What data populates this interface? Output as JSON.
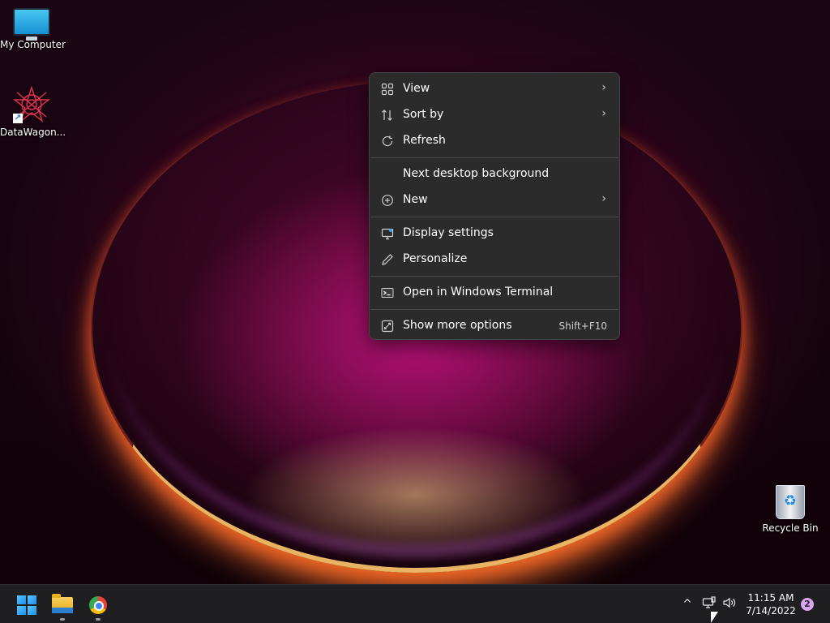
{
  "desktop": {
    "icons": [
      {
        "label": "My Computer",
        "icon": "monitor-icon"
      },
      {
        "label": "DataWagon...",
        "icon": "datawagon-star-icon"
      },
      {
        "label": "Recycle Bin",
        "icon": "recycle-bin-icon"
      }
    ]
  },
  "context_menu": {
    "items": [
      {
        "label": "View",
        "icon": "grid-icon",
        "submenu": true
      },
      {
        "label": "Sort by",
        "icon": "sort-icon",
        "submenu": true
      },
      {
        "label": "Refresh",
        "icon": "refresh-icon"
      },
      {
        "label": "Next desktop background",
        "icon": ""
      },
      {
        "label": "New",
        "icon": "plus-circle-icon",
        "submenu": true
      },
      {
        "label": "Display settings",
        "icon": "display-icon"
      },
      {
        "label": "Personalize",
        "icon": "pen-icon"
      },
      {
        "label": "Open in Windows Terminal",
        "icon": "terminal-icon"
      },
      {
        "label": "Show more options",
        "icon": "expand-icon",
        "shortcut": "Shift+F10"
      }
    ]
  },
  "taskbar": {
    "apps": [
      {
        "name": "Start",
        "icon": "windows-start-icon"
      },
      {
        "name": "File Explorer",
        "icon": "folder-icon"
      },
      {
        "name": "Google Chrome",
        "icon": "chrome-icon"
      }
    ],
    "clock": {
      "time": "11:15 AM",
      "date": "7/14/2022"
    },
    "notification_count": "2"
  },
  "colors": {
    "menu_bg": "#2b2b2b",
    "taskbar_bg": "#1f1f21",
    "accent": "#1b8ff0"
  }
}
